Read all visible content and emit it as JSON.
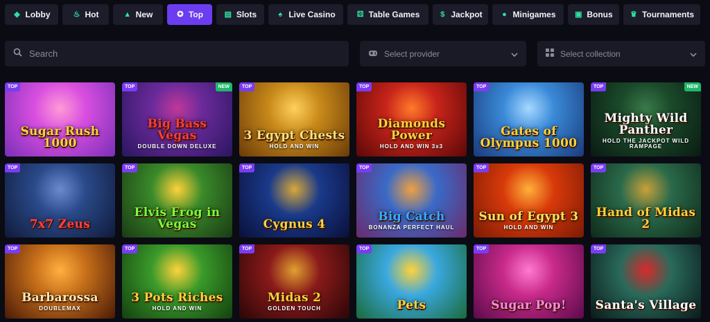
{
  "nav": {
    "tabs": [
      {
        "label": "Lobby",
        "icon": "gamepad-icon",
        "glyph": "◆",
        "active": false
      },
      {
        "label": "Hot",
        "icon": "flame-icon",
        "glyph": "♨",
        "active": false
      },
      {
        "label": "New",
        "icon": "bell-icon",
        "glyph": "▲",
        "active": false
      },
      {
        "label": "Top",
        "icon": "star-circle-icon",
        "glyph": "✪",
        "active": true
      },
      {
        "label": "Slots",
        "icon": "slot-machine-icon",
        "glyph": "▤",
        "active": false
      },
      {
        "label": "Live Casino",
        "icon": "cards-icon",
        "glyph": "♠",
        "active": false
      },
      {
        "label": "Table Games",
        "icon": "dice-icon",
        "glyph": "⚄",
        "active": false
      },
      {
        "label": "Jackpot",
        "icon": "coins-icon",
        "glyph": "$",
        "active": false
      },
      {
        "label": "Minigames",
        "icon": "bomb-icon",
        "glyph": "●",
        "active": false
      },
      {
        "label": "Bonus",
        "icon": "gift-icon",
        "glyph": "▣",
        "active": false
      },
      {
        "label": "Tournaments",
        "icon": "trophy-icon",
        "glyph": "♛",
        "active": false
      }
    ]
  },
  "search": {
    "placeholder": "Search"
  },
  "provider_select": {
    "placeholder": "Select provider"
  },
  "collection_select": {
    "placeholder": "Select collection"
  },
  "badges": {
    "top": "TOP",
    "new": "NEW"
  },
  "games": [
    {
      "title": "Sugar Rush 1000",
      "sub": "",
      "badge": "TOP",
      "extra_badge": "",
      "colors": [
        "#d94fe0",
        "#7a2fb8",
        "#ff9ad6"
      ],
      "title_color": "#ffd23a"
    },
    {
      "title": "Big Bass Vegas",
      "sub": "DOUBLE DOWN DELUXE",
      "badge": "TOP",
      "extra_badge": "NEW",
      "colors": [
        "#6a2a9a",
        "#2a1660",
        "#c0389a"
      ],
      "title_color": "#ff3b3b"
    },
    {
      "title": "3 Egypt Chests",
      "sub": "HOLD AND WIN",
      "badge": "TOP",
      "extra_badge": "",
      "colors": [
        "#c98a1a",
        "#6a3a08",
        "#ffd05a"
      ],
      "title_color": "#ffe27a"
    },
    {
      "title": "Diamonds Power",
      "sub": "HOLD AND WIN 3x3",
      "badge": "TOP",
      "extra_badge": "",
      "colors": [
        "#c8241a",
        "#5a0808",
        "#ff7a2a"
      ],
      "title_color": "#ffd23a"
    },
    {
      "title": "Gates of Olympus 1000",
      "sub": "",
      "badge": "TOP",
      "extra_badge": "",
      "colors": [
        "#3a8ad8",
        "#1a3a7a",
        "#a6d8ff"
      ],
      "title_color": "#ffd23a"
    },
    {
      "title": "Mighty Wild Panther",
      "sub": "HOLD THE JACKPOT WILD RAMPAGE",
      "badge": "TOP",
      "extra_badge": "NEW",
      "colors": [
        "#1a4a2a",
        "#0a1a12",
        "#3a7a4a"
      ],
      "title_color": "#ffffff"
    },
    {
      "title": "7x7 Zeus",
      "sub": "",
      "badge": "TOP",
      "extra_badge": "",
      "colors": [
        "#2a4a8a",
        "#101a3a",
        "#6a8acf"
      ],
      "title_color": "#ff4040"
    },
    {
      "title": "Elvis Frog in Vegas",
      "sub": "",
      "badge": "TOP",
      "extra_badge": "",
      "colors": [
        "#3a8a2a",
        "#1a3a14",
        "#ffd23a"
      ],
      "title_color": "#7aff3a"
    },
    {
      "title": "Cygnus 4",
      "sub": "",
      "badge": "TOP",
      "extra_badge": "",
      "colors": [
        "#1a3a8a",
        "#0a0f3a",
        "#d8a83a"
      ],
      "title_color": "#ffd23a"
    },
    {
      "title": "Big Catch",
      "sub": "BONANZA PERFECT HAUL",
      "badge": "TOP",
      "extra_badge": "",
      "colors": [
        "#3a6ac8",
        "#6a2a6a",
        "#f0a040"
      ],
      "title_color": "#3aa8ff"
    },
    {
      "title": "Sun of Egypt 3",
      "sub": "HOLD AND WIN",
      "badge": "TOP",
      "extra_badge": "",
      "colors": [
        "#d83a0a",
        "#7a1a04",
        "#ffb03a"
      ],
      "title_color": "#ffe25a"
    },
    {
      "title": "Hand of Midas 2",
      "sub": "",
      "badge": "TOP",
      "extra_badge": "",
      "colors": [
        "#2a6a4a",
        "#0f2a1a",
        "#c8a03a"
      ],
      "title_color": "#ffd23a"
    },
    {
      "title": "Barbarossa",
      "sub": "DOUBLEMAX",
      "badge": "TOP",
      "extra_badge": "",
      "colors": [
        "#c8701a",
        "#4a1a06",
        "#ffb040"
      ],
      "title_color": "#ffe8b0"
    },
    {
      "title": "3 Pots Riches",
      "sub": "HOLD AND WIN",
      "badge": "TOP",
      "extra_badge": "",
      "colors": [
        "#3a9a2a",
        "#14400f",
        "#ffd23a"
      ],
      "title_color": "#ffd23a"
    },
    {
      "title": "Midas 2",
      "sub": "GOLDEN TOUCH",
      "badge": "TOP",
      "extra_badge": "",
      "colors": [
        "#8a1a1a",
        "#2a0606",
        "#e0a030"
      ],
      "title_color": "#ffd23a"
    },
    {
      "title": "Pets",
      "sub": "",
      "badge": "TOP",
      "extra_badge": "",
      "colors": [
        "#3aa8e0",
        "#1a6a3a",
        "#ffd23a"
      ],
      "title_color": "#ffd23a"
    },
    {
      "title": "Sugar Pop!",
      "sub": "",
      "badge": "TOP",
      "extra_badge": "",
      "colors": [
        "#c82a8a",
        "#5a0a4a",
        "#ff7ad0"
      ],
      "title_color": "#ff8ad8"
    },
    {
      "title": "Santa's Village",
      "sub": "",
      "badge": "TOP",
      "extra_badge": "",
      "colors": [
        "#2a6a5a",
        "#0a1a1a",
        "#d82a2a"
      ],
      "title_color": "#ffffff"
    }
  ]
}
